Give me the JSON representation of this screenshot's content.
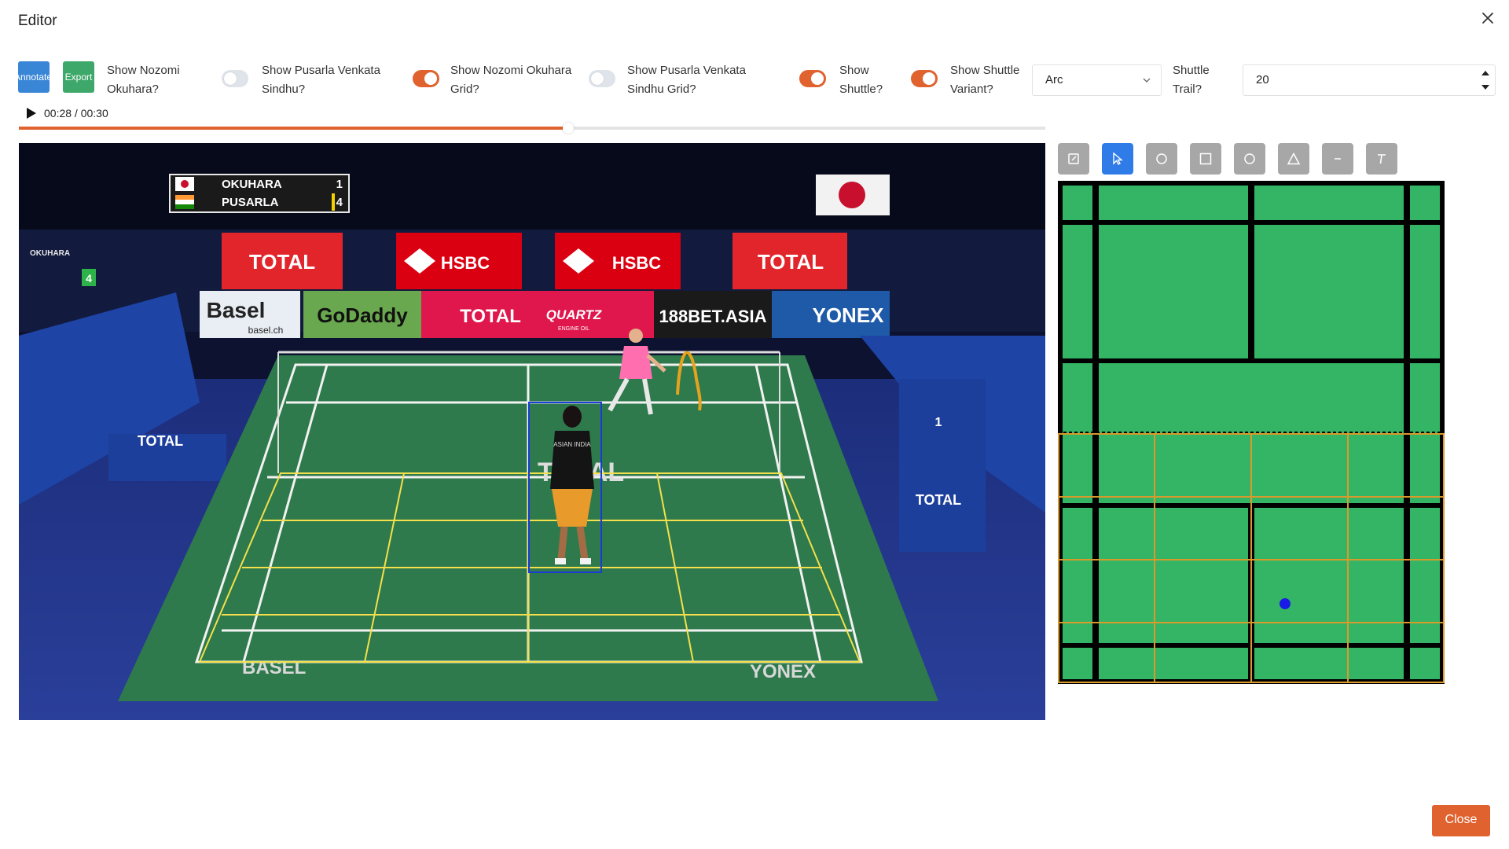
{
  "dialog": {
    "title": "Editor",
    "close_label": "Close"
  },
  "toolbar": {
    "annotate_label": "Annotate",
    "export_label": "Export",
    "toggles": [
      {
        "line1": "Show Nozomi",
        "line2": "Okuhara?",
        "on": false
      },
      {
        "line1": "Show Pusarla Venkata",
        "line2": "Sindhu?",
        "on": true
      },
      {
        "line1": "Show Nozomi Okuhara",
        "line2": "Grid?",
        "on": false
      },
      {
        "line1": "Show Pusarla Venkata",
        "line2": "Sindhu Grid?",
        "on": true
      },
      {
        "line1": "Show",
        "line2": "Shuttle?",
        "on": true
      },
      {
        "line1": "Show Shuttle",
        "line2": "Variant?",
        "on": null
      }
    ],
    "shuttle_variant": {
      "value": "Arc"
    },
    "shuttle_trail": {
      "line1": "Shuttle",
      "line2": "Trail?",
      "value": "20"
    }
  },
  "player": {
    "time": "00:28 / 00:30",
    "progress": 0.535
  },
  "video": {
    "scoreboard": [
      {
        "name": "OKUHARA",
        "score": "1"
      },
      {
        "name": "PUSARLA",
        "score": "4"
      }
    ],
    "side_board": {
      "name": "OKUHARA",
      "score": "4"
    },
    "umpire_score": "1",
    "sponsors": {
      "total": "TOTAL",
      "hsbc": "HSBC",
      "basel": "Basel",
      "basel_url": "basel.ch",
      "godaddy": "GoDaddy",
      "quartz": "QUARTZ",
      "quartz_sub": "ENGINE OIL",
      "bet": "188BET.ASIA",
      "yonex": "YONEX",
      "court_basel": "BASEL",
      "court_total": "TOTAL"
    },
    "shirt_text": "ASIAN INDIA"
  },
  "drawing_tools": [
    {
      "name": "edit-tool",
      "icon": "pencil-square-icon",
      "active": false
    },
    {
      "name": "select-tool",
      "icon": "cursor-arrow-icon",
      "active": true
    },
    {
      "name": "circle-tool",
      "icon": "circle-icon",
      "active": false
    },
    {
      "name": "rectangle-tool",
      "icon": "square-icon",
      "active": false
    },
    {
      "name": "ellipse-tool",
      "icon": "circle-outline-icon",
      "active": false
    },
    {
      "name": "triangle-tool",
      "icon": "triangle-icon",
      "active": false
    },
    {
      "name": "line-tool",
      "icon": "line-icon",
      "active": false
    },
    {
      "name": "text-tool",
      "icon": "text-icon",
      "active": false
    }
  ],
  "minimap": {
    "court_color": "#34b566",
    "grid_color": "#d99a2b",
    "marker_color": "#1a1ae6"
  },
  "colors": {
    "accent": "#e0622e",
    "primary": "#2f7be8",
    "export": "#3da86a",
    "annotate": "#3a86d6"
  }
}
